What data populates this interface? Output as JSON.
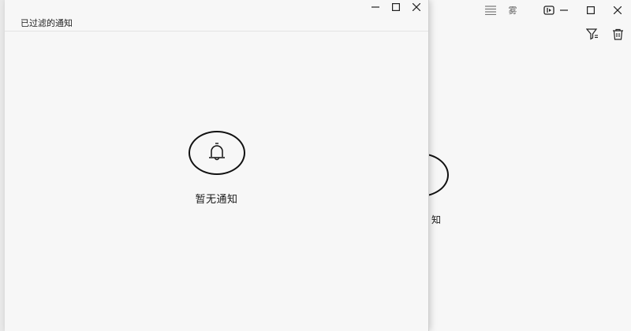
{
  "foreground_window": {
    "title": "已过滤的通知",
    "titlebar_buttons": [
      "minimize-icon",
      "maximize-icon",
      "close-icon"
    ],
    "empty_state": {
      "icon": "bell-icon",
      "message": "暂无通知"
    }
  },
  "background_window": {
    "toolbar_icons": [
      "menu-lines-icon",
      "weather-icon",
      "pin-window-icon"
    ],
    "toolbar_text": "雾",
    "titlebar_buttons": [
      "minimize-icon",
      "maximize-icon",
      "close-icon"
    ],
    "actions": [
      "filter-icon",
      "trash-icon"
    ],
    "empty_state": {
      "icon": "bell-icon",
      "message_partial": "知"
    }
  },
  "colors": {
    "window_bg": "#f7f7f7",
    "icon_stroke": "#111111",
    "text": "#1a1a1a"
  }
}
